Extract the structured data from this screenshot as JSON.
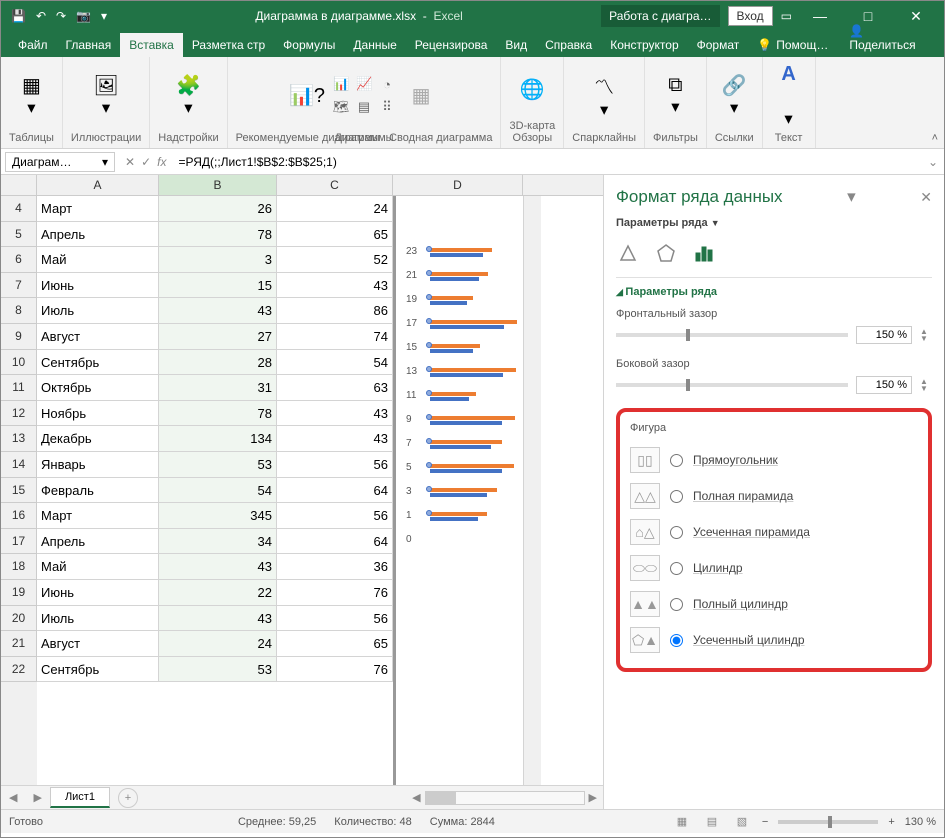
{
  "title": {
    "doc": "Диаграмма в диаграмме.xlsx",
    "app": "Excel",
    "contextual": "Работа с диагра…",
    "login": "Вход"
  },
  "tabs": {
    "file": "Файл",
    "home": "Главная",
    "insert": "Вставка",
    "layout": "Разметка стр",
    "formulas": "Формулы",
    "data": "Данные",
    "review": "Рецензирова",
    "view": "Вид",
    "help": "Справка",
    "design": "Конструктор",
    "format": "Формат",
    "tell": "Помощ…",
    "share": "Поделиться"
  },
  "ribbon": {
    "tables": "Таблицы",
    "illustrations": "Иллюстрации",
    "addins": "Надстройки",
    "reccharts": "Рекомендуемые диаграммы",
    "charts_group": "Диаграммы",
    "pivotchart": "Сводная диаграмма",
    "map3d": "3D-карта",
    "tours": "Обзоры",
    "sparklines": "Спарклайны",
    "filters": "Фильтры",
    "links": "Ссылки",
    "text": "Текст"
  },
  "namebox": "Диаграм…",
  "formula": "=РЯД(;;Лист1!$B$2:$B$25;1)",
  "columns": [
    "A",
    "B",
    "C",
    "D"
  ],
  "rows": [
    {
      "n": 4,
      "a": "Март",
      "b": 26,
      "c": 24
    },
    {
      "n": 5,
      "a": "Апрель",
      "b": 78,
      "c": 65
    },
    {
      "n": 6,
      "a": "Май",
      "b": 3,
      "c": 52
    },
    {
      "n": 7,
      "a": "Июнь",
      "b": 15,
      "c": 43
    },
    {
      "n": 8,
      "a": "Июль",
      "b": 43,
      "c": 86
    },
    {
      "n": 9,
      "a": "Август",
      "b": 27,
      "c": 74
    },
    {
      "n": 10,
      "a": "Сентябрь",
      "b": 28,
      "c": 54
    },
    {
      "n": 11,
      "a": "Октябрь",
      "b": 31,
      "c": 63
    },
    {
      "n": 12,
      "a": "Ноябрь",
      "b": 78,
      "c": 43
    },
    {
      "n": 13,
      "a": "Декабрь",
      "b": 134,
      "c": 43
    },
    {
      "n": 14,
      "a": "Январь",
      "b": 53,
      "c": 56
    },
    {
      "n": 15,
      "a": "Февраль",
      "b": 54,
      "c": 64
    },
    {
      "n": 16,
      "a": "Март",
      "b": 345,
      "c": 56
    },
    {
      "n": 17,
      "a": "Апрель",
      "b": 34,
      "c": 64
    },
    {
      "n": 18,
      "a": "Май",
      "b": 43,
      "c": 36
    },
    {
      "n": 19,
      "a": "Июнь",
      "b": 22,
      "c": 76
    },
    {
      "n": 20,
      "a": "Июль",
      "b": 43,
      "c": 56
    },
    {
      "n": 21,
      "a": "Август",
      "b": 24,
      "c": 65
    },
    {
      "n": 22,
      "a": "Сентябрь",
      "b": 53,
      "c": 76
    }
  ],
  "chart_axis": [
    23,
    21,
    19,
    17,
    15,
    13,
    11,
    9,
    7,
    5,
    3,
    1,
    0
  ],
  "pane": {
    "title": "Формат ряда данных",
    "sub": "Параметры ряда",
    "section": "Параметры ряда",
    "gap_depth": "Фронтальный зазор",
    "gap_width": "Боковой зазор",
    "gap_val1": "150 %",
    "gap_val2": "150 %",
    "figure": "Фигура",
    "opts": {
      "box": "Прямоугольник",
      "pyr_full": "Полная пирамида",
      "pyr_partial": "Усеченная пирамида",
      "cyl": "Цилиндр",
      "cyl_full": "Полный цилиндр",
      "cyl_partial": "Усеченный цилиндр"
    }
  },
  "sheet_tab": "Лист1",
  "status": {
    "ready": "Готово",
    "avg_label": "Среднее:",
    "avg": "59,25",
    "count_label": "Количество:",
    "count": "48",
    "sum_label": "Сумма:",
    "sum": "2844",
    "zoom": "130 %"
  }
}
